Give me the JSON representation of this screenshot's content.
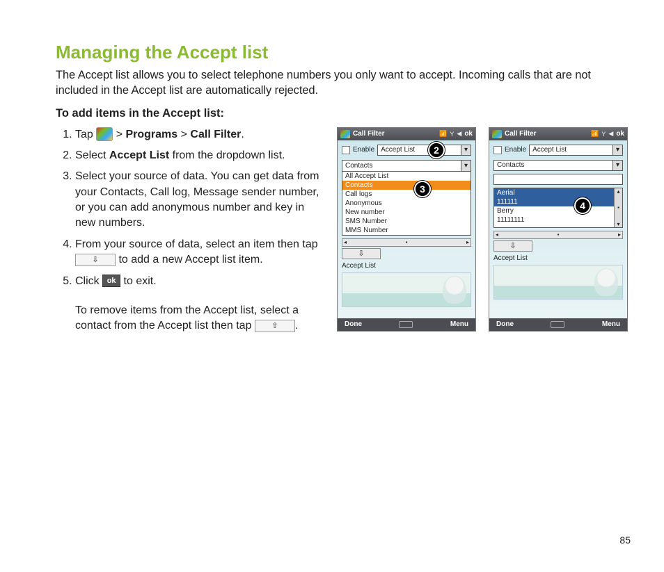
{
  "title": "Managing the Accept list",
  "intro": "The Accept list allows you to select telephone numbers you only want to accept. Incoming calls that are not included in the Accept list are automatically rejected.",
  "subhead": "To add items in the Accept list:",
  "steps": {
    "s1_a": "Tap ",
    "s1_b": " > ",
    "s1_programs": "Programs",
    "s1_c": " > ",
    "s1_callfilter": "Call Filter",
    "s1_d": ".",
    "s2_a": "Select ",
    "s2_accept": "Accept List",
    "s2_b": " from the dropdown list.",
    "s3": "Select your source of data. You can get data from your Contacts, Call log, Message sender number, or you can add anonymous number and key in new numbers.",
    "s4_a": "From your source of data, select an item then tap ",
    "s4_b": " to add a new Accept list item.",
    "s5_a": "Click ",
    "s5_b": " to exit.",
    "note_a": "To remove items from the Accept list, select a contact from the Accept list then tap ",
    "note_b": "."
  },
  "iconlabels": {
    "down": "⇩",
    "up": "⇧",
    "ok": "ok"
  },
  "phone": {
    "titlebar_app": "Call Filter",
    "titlebar_ok": "ok",
    "enable": "Enable",
    "combo_value": "Accept List",
    "source_options": [
      "All Accept List",
      "Contacts",
      "Call logs",
      "Anonymous",
      "New number",
      "SMS Number",
      "MMS Number"
    ],
    "source_selected_index": 1,
    "contacts_header": "Contacts",
    "contact_rows": [
      {
        "name": "Aerial",
        "num": "111111",
        "sel": true
      },
      {
        "name": "Berry",
        "num": "11111111",
        "sel": false
      }
    ],
    "accept_label": "Accept List",
    "soft_left": "Done",
    "soft_right": "Menu"
  },
  "callouts": {
    "c2": "2",
    "c3": "3",
    "c4": "4"
  },
  "page_number": "85"
}
